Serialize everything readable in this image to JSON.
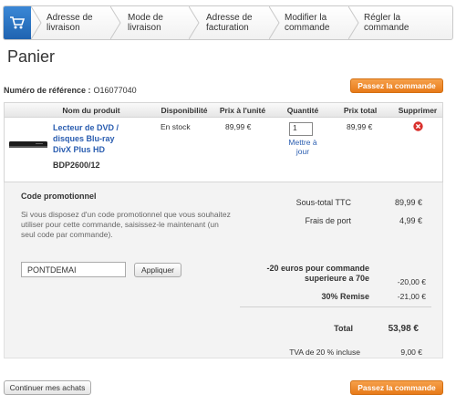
{
  "steps": [
    {
      "line1": "Adresse de",
      "line2": "livraison"
    },
    {
      "line1": "Mode de",
      "line2": "livraison"
    },
    {
      "line1": "Adresse de",
      "line2": "facturation"
    },
    {
      "line1": "Modifier la",
      "line2": "commande"
    },
    {
      "line1": "Régler la",
      "line2": "commande"
    }
  ],
  "page_title": "Panier",
  "reference": {
    "label": "Numéro de référence :",
    "value": "O16077040"
  },
  "checkout_label": "Passez la commande",
  "table": {
    "headers": {
      "product": "Nom du produit",
      "availability": "Disponibilité",
      "unit_price": "Prix à l'unité",
      "quantity": "Quantité",
      "total": "Prix total",
      "remove": "Supprimer"
    },
    "row": {
      "name_lines": [
        "Lecteur de DVD /",
        "disques Blu-ray",
        "DivX Plus HD"
      ],
      "code": "BDP2600/12",
      "availability": "En stock",
      "unit_price": "89,99 €",
      "quantity": "1",
      "update_line1": "Mettre à",
      "update_line2": "jour",
      "total": "89,99 €"
    }
  },
  "promo": {
    "title": "Code promotionnel",
    "text": "Si vous disposez d'un code promotionnel que vous souhaitez utiliser pour cette commande, saisissez-le maintenant (un seul code par commande).",
    "code_value": "PONTDEMAI",
    "apply_label": "Appliquer"
  },
  "totals": {
    "subtotal_label": "Sous-total TTC",
    "subtotal_value": "89,99 €",
    "shipping_label": "Frais de port",
    "shipping_value": "4,99 €",
    "discount1_line1": "-20 euros pour commande",
    "discount1_line2": "superieure a 70e",
    "discount1_value": "-20,00 €",
    "discount2_label": "30% Remise",
    "discount2_value": "-21,00 €",
    "total_label": "Total",
    "total_value": "53,98 €",
    "vat_label": "TVA de 20 % incluse",
    "vat_value": "9,00 €"
  },
  "continue_label": "Continuer mes achats",
  "colors": {
    "accent_orange": "#e87a19",
    "link_blue": "#2a5db0",
    "remove_red": "#d9302c"
  }
}
